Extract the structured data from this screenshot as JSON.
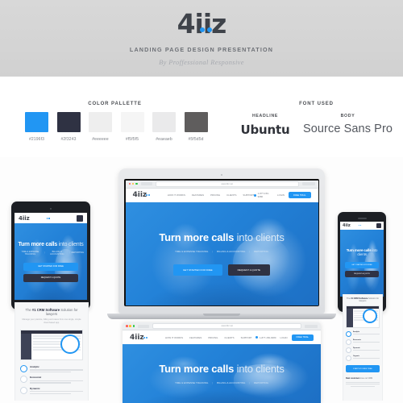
{
  "header": {
    "logo": "4iiz",
    "subtitle": "LANDING PAGE DESIGN PRESENTATION",
    "byline": "By Proffessional Responsive"
  },
  "palette": {
    "title": "COLOR PALLETTE",
    "swatches": [
      {
        "hex": "#2196f3",
        "label": "#2196f3"
      },
      {
        "hex": "#2f3243",
        "label": "#2f3243"
      },
      {
        "hex": "#eeeeee",
        "label": "#eeeeee"
      },
      {
        "hex": "#f5f5f5",
        "label": "#f5f5f5"
      },
      {
        "hex": "#eaeaeb",
        "label": "#eaeaeb"
      },
      {
        "hex": "#5f5d5d",
        "label": "#5f5d5d"
      }
    ]
  },
  "fonts": {
    "title": "FONT USED",
    "headline_label": "HEADLINE",
    "headline_name": "Ubuntu",
    "body_label": "BODY",
    "body_name": "Source Sans Pro"
  },
  "site": {
    "logo": "4iiz",
    "url": "www.4iiz.net",
    "nav": [
      "HOW IT WORKS",
      "FEATURES",
      "PRICING",
      "CLIENTS",
      "SUPPORT"
    ],
    "phone": "1-877-150-9080",
    "login": "LOGIN",
    "nav_cta": "FREE TRIAL",
    "hero_title_strong": "Turn more calls",
    "hero_title_light": "into clients",
    "tags": [
      "TIME & EXPENSE TRACKING",
      "BILLING & ACCOUNTING",
      "REPORTING"
    ],
    "cta_primary": "GET STARTED FOR FREE",
    "cta_secondary": "REQUEST A QUOTE",
    "section_heading_pre": "The ",
    "section_heading_strong": "#1 CRM Software",
    "section_heading_post": " Solution for lawyers",
    "section_sub": "Manage your practice, billing and cases from one single, simple cloud based app.",
    "features": [
      {
        "name": "Analytic",
        "desc": "Lorem ipsum dolor sit amet consectetur adipiscing elit."
      },
      {
        "name": "Economic",
        "desc": "Lorem ipsum dolor sit amet consectetur adipiscing elit."
      },
      {
        "name": "Dynamic",
        "desc": "Lorem ipsum dolor sit amet consectetur adipiscing elit."
      },
      {
        "name": "Organic",
        "desc": "Lorem ipsum dolor sit amet consectetur adipiscing elit."
      }
    ],
    "mobile_cta": "START MY FREE TRIAL",
    "footer_heading_strong": "Real customers",
    "footer_heading_rest": " love our CRM"
  }
}
